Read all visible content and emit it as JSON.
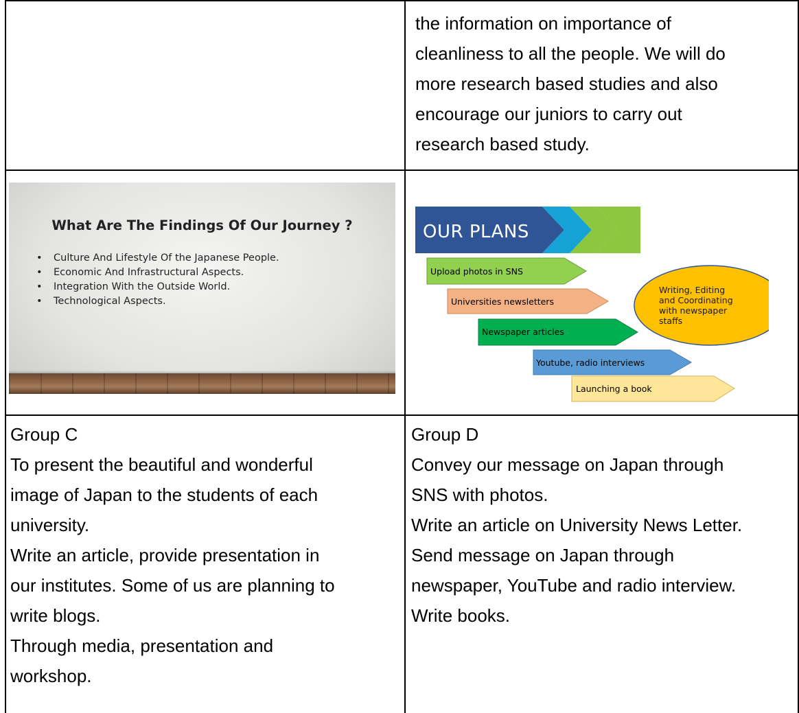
{
  "top_right_text": [
    "the information on importance of",
    "cleanliness to all the people. We will do",
    "more research based studies and also",
    "encourage our juniors to carry out",
    "research based study."
  ],
  "slide": {
    "title": "What Are The Findings Of Our Journey ?",
    "bullets": [
      "Culture And Lifestyle Of the Japanese People.",
      "Economic And Infrastructural Aspects.",
      "Integration With the Outside World.",
      "Technological Aspects."
    ]
  },
  "plans": {
    "title": "OUR PLANS",
    "items": [
      {
        "label": "Upload photos in SNS",
        "color": "#92d050"
      },
      {
        "label": "Universities newsletters",
        "color": "#f4b183"
      },
      {
        "label": "Newspaper articles",
        "color": "#00b050"
      },
      {
        "label": "Youtube, radio interviews",
        "color": "#5b9bd5"
      },
      {
        "label": "Launching a book",
        "color": "#ffe699"
      }
    ],
    "oval_lines": [
      "Writing, Editing",
      "and Coordinating",
      "with newspaper",
      "staffs"
    ],
    "oval_color": "#ffc000",
    "banner_color": "#2f5597"
  },
  "group_c": {
    "lines": [
      "Group C",
      "To present the beautiful and wonderful",
      "image of Japan to the students of each",
      "university.",
      "Write an article, provide presentation in",
      "our institutes. Some of us are planning to",
      "write blogs.",
      "Through media, presentation and",
      "workshop."
    ]
  },
  "group_d": {
    "lines": [
      "Group D",
      "Convey our message on Japan through",
      "SNS with photos.",
      "Write an article on University News Letter.",
      "Send message on Japan through",
      "newspaper, YouTube and radio interview.",
      "Write books."
    ]
  }
}
